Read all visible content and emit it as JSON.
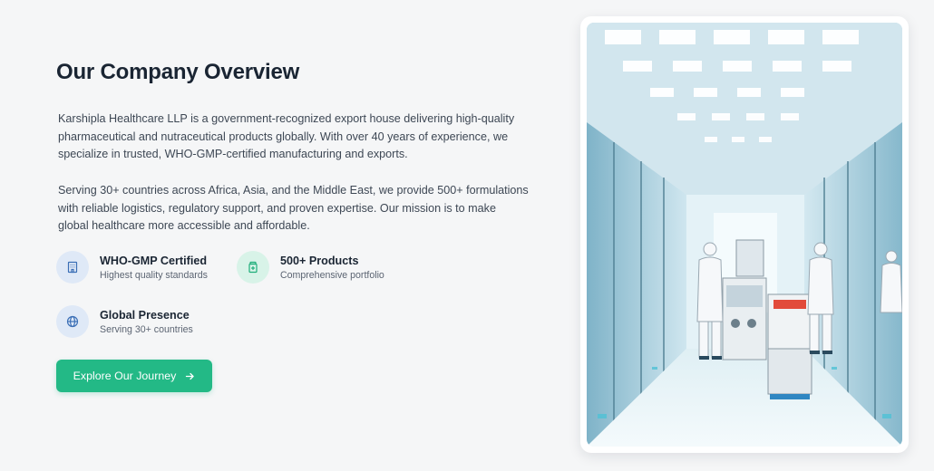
{
  "section": {
    "title": "Our Company Overview",
    "paragraphs": [
      "Karshipla Healthcare LLP is a government-recognized export house delivering high-quality pharmaceutical and nutraceutical products globally. With over 40 years of experience, we specialize in trusted, WHO-GMP-certified manufacturing and exports.",
      "Serving 30+ countries across Africa, Asia, and the Middle East, we provide 500+ formulations with reliable logistics, regulatory support, and proven expertise. Our mission is to make global healthcare more accessible and affordable."
    ]
  },
  "features": [
    {
      "title": "WHO-GMP Certified",
      "subtitle": "Highest quality standards",
      "icon": "building-icon",
      "color": "#3b6fb6"
    },
    {
      "title": "500+ Products",
      "subtitle": "Comprehensive portfolio",
      "icon": "medicine-bottle-icon",
      "color": "#1fae7a"
    },
    {
      "title": "Global Presence",
      "subtitle": "Serving 30+ countries",
      "icon": "globe-icon",
      "color": "#3b6fb6"
    }
  ],
  "cta": {
    "label": "Explore Our Journey",
    "icon": "arrow-right-icon",
    "color": "#23b986"
  },
  "image": {
    "subject": "cleanroom-manufacturing-lab-photo"
  }
}
